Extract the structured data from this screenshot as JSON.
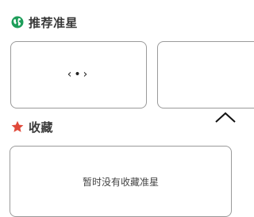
{
  "recommend": {
    "title": "推荐准星",
    "icon": "globe-icon",
    "icon_color": "#1e9e5a",
    "cards": [
      {
        "preview_glyph": "‹•›"
      },
      {
        "preview_icon": "chevron-up-icon"
      }
    ]
  },
  "favorites": {
    "title": "收藏",
    "icon": "star-icon",
    "icon_color": "#e0493a",
    "empty_message": "暂时没有收藏准星"
  }
}
